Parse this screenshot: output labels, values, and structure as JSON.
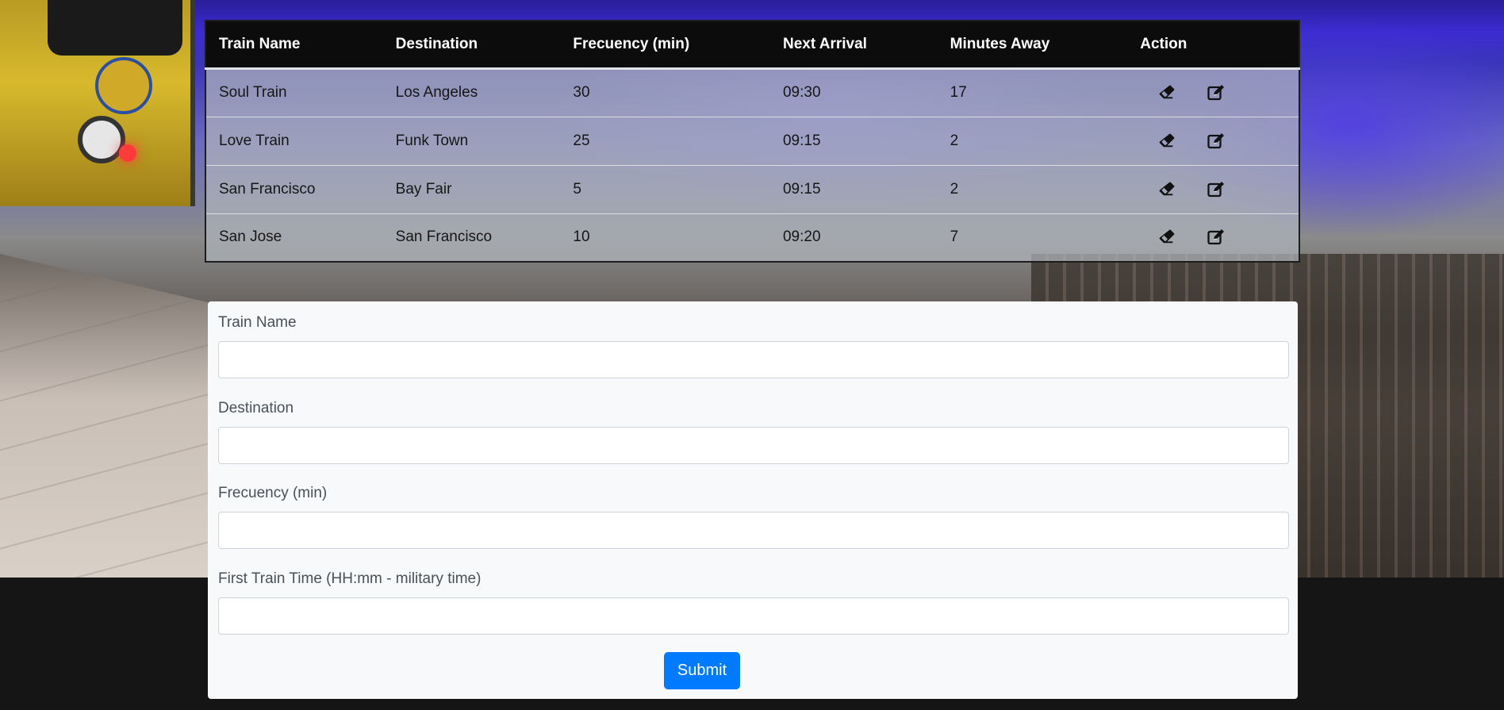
{
  "table": {
    "headers": [
      "Train Name",
      "Destination",
      "Frecuency (min)",
      "Next Arrival",
      "Minutes Away",
      "Action"
    ],
    "rows": [
      {
        "name": "Soul Train",
        "destination": "Los Angeles",
        "frequency": "30",
        "next_arrival": "09:30",
        "minutes_away": "17"
      },
      {
        "name": "Love Train",
        "destination": "Funk Town",
        "frequency": "25",
        "next_arrival": "09:15",
        "minutes_away": "2"
      },
      {
        "name": "San Francisco",
        "destination": "Bay Fair",
        "frequency": "5",
        "next_arrival": "09:15",
        "minutes_away": "2"
      },
      {
        "name": "San Jose",
        "destination": "San Francisco",
        "frequency": "10",
        "next_arrival": "09:20",
        "minutes_away": "7"
      }
    ],
    "action_icons": [
      "eraser-icon",
      "edit-icon"
    ]
  },
  "form": {
    "train_name_label": "Train Name",
    "train_name_value": "",
    "destination_label": "Destination",
    "destination_value": "",
    "frequency_label": "Frecuency (min)",
    "frequency_value": "",
    "first_train_label": "First Train Time (HH:mm - military time)",
    "first_train_value": "",
    "submit_label": "Submit"
  },
  "colors": {
    "accent": "#007bff",
    "header_bg": "#0c0c0c",
    "form_bg": "#f8f9fa"
  }
}
